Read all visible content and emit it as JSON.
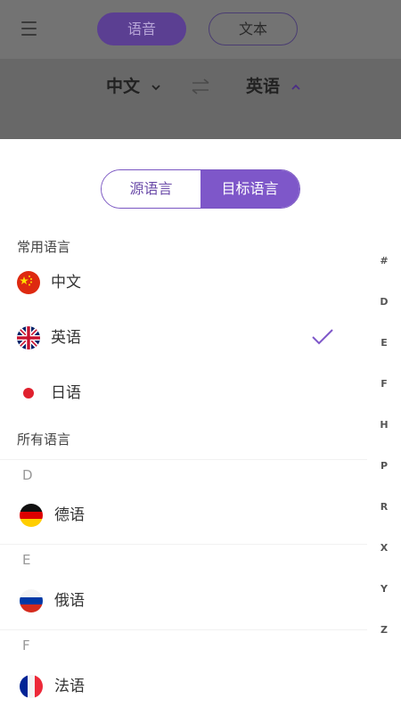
{
  "header": {
    "menu_icon": "hamburger-menu-icon",
    "mode_tabs": [
      {
        "label": "语音",
        "selected": true
      },
      {
        "label": "文本",
        "selected": false
      }
    ],
    "source_language": "中文",
    "target_language": "英语",
    "swap_icon": "swap-arrows-icon"
  },
  "sheet": {
    "segments": [
      {
        "label": "源语言",
        "selected": false
      },
      {
        "label": "目标语言",
        "selected": true
      }
    ],
    "common_title": "常用语言",
    "common": [
      {
        "name": "中文",
        "flag": "china-flag-icon",
        "checked": false
      },
      {
        "name": "英语",
        "flag": "uk-flag-icon",
        "checked": true
      },
      {
        "name": "日语",
        "flag": "japan-flag-icon",
        "checked": false
      }
    ],
    "all_title": "所有语言",
    "groups": [
      {
        "letter": "D",
        "languages": [
          {
            "name": "德语",
            "flag": "germany-flag-icon"
          }
        ]
      },
      {
        "letter": "E",
        "languages": [
          {
            "name": "俄语",
            "flag": "russia-flag-icon"
          }
        ]
      },
      {
        "letter": "F",
        "languages": [
          {
            "name": "法语",
            "flag": "france-flag-icon"
          }
        ]
      }
    ],
    "index": [
      "#",
      "D",
      "E",
      "F",
      "H",
      "P",
      "R",
      "X",
      "Y",
      "Z"
    ]
  },
  "colors": {
    "accent": "#7e57c9",
    "overlay": "#737373"
  }
}
